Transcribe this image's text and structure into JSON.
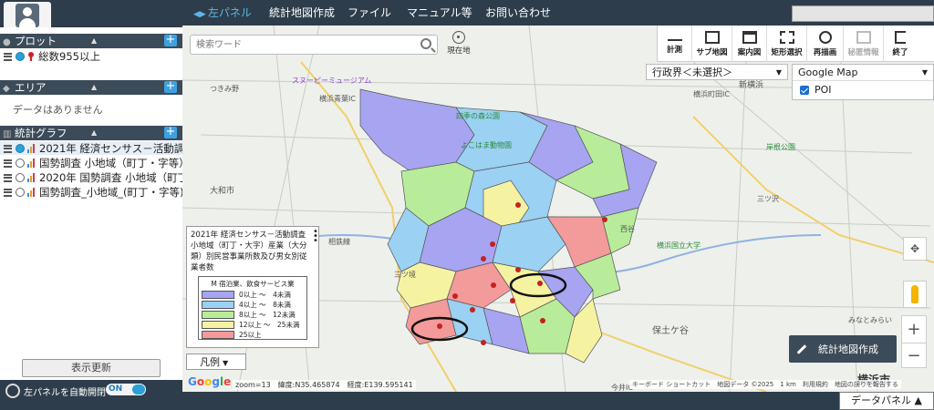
{
  "topbar": {
    "menus": [
      "左パネル",
      "統計地図作成",
      "ファイル",
      "マニュアル等",
      "お問い合わせ"
    ]
  },
  "leftpanel": {
    "plot": {
      "title": "プロット",
      "items": [
        "総数955以上"
      ]
    },
    "area": {
      "title": "エリア",
      "empty": "データはありません"
    },
    "graph": {
      "title": "統計グラフ",
      "items": [
        "2021年 経済センサス－活動調査",
        "国勢調査 小地域（町丁・字等）",
        "2020年 国勢調査 小地域（町丁",
        "国勢調査_小地域_(町丁・字等)"
      ]
    },
    "update_label": "表示更新",
    "auto_label": "左パネルを自動開閉",
    "auto_state": "ON"
  },
  "map": {
    "search_placeholder": "検索ワード",
    "current_location": "現在地",
    "tools": [
      "計測",
      "サブ地図",
      "案内図",
      "矩形選択",
      "再描画",
      "秘匿情報",
      "終了"
    ],
    "admin_select": "行政界＜未選択＞",
    "base_map": "Google Map",
    "poi_label": "POI",
    "create_label": "統計地図作成",
    "legend_button": "凡例",
    "coords": "zoom=13　緯度:N35.465874　経度:E139.595141",
    "attribution": "キーボード ショートカット　地図データ ©2025　1 km　利用規約　地図の誤りを報告する",
    "labels": [
      "つきみ野",
      "スヌーピーミュージアム",
      "横浜青葉IC",
      "四季の森公園",
      "よこはま動物園",
      "大和市",
      "三ツ境",
      "相鉄線",
      "横浜国立大学",
      "横浜町田IC",
      "新横浜",
      "岸根公園",
      "三ツ沢",
      "横浜市",
      "保土ケ谷",
      "みなとみらい",
      "今井IC",
      "西谷"
    ]
  },
  "legend": {
    "title": "2021年 経済センサス－活動調査 小地域（町丁・大字）産業（大分類）別民営事業所数及び男女別従業者数",
    "subtitle": "M 宿泊業、飲食サービス業",
    "rows": [
      {
        "label": "0以上 ～　4未満",
        "color": "#a7a4f2"
      },
      {
        "label": "4以上 ～　8未満",
        "color": "#9bd1f3"
      },
      {
        "label": "8以上 ～　12未満",
        "color": "#b8ec9a"
      },
      {
        "label": "12以上 ～　25未満",
        "color": "#f5f3a2"
      },
      {
        "label": "25以上",
        "color": "#f39a9a"
      }
    ]
  },
  "footer": {
    "datapanel_label": "データパネル ▲"
  }
}
